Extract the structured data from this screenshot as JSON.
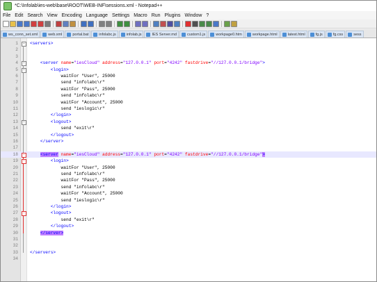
{
  "window": {
    "title": "*C:\\Infolab\\ies-web\\base\\ROOT\\WEB-INF\\sessions.xml - Notepad++"
  },
  "menu": [
    "File",
    "Edit",
    "Search",
    "View",
    "Encoding",
    "Language",
    "Settings",
    "Macro",
    "Run",
    "Plugins",
    "Window",
    "?"
  ],
  "toolbar": {
    "icons": [
      {
        "name": "new-file-icon",
        "color": "#ffffff"
      },
      {
        "name": "open-file-icon",
        "color": "#e8c04a"
      },
      {
        "name": "save-icon",
        "color": "#4a78c8"
      },
      {
        "name": "save-all-icon",
        "color": "#4a78c8"
      },
      {
        "name": "close-icon",
        "color": "#d04040"
      },
      {
        "name": "close-all-icon",
        "color": "#d04040"
      },
      {
        "name": "print-icon",
        "color": "#7a7a7a"
      },
      {
        "name": "sep"
      },
      {
        "name": "cut-icon",
        "color": "#c04040"
      },
      {
        "name": "copy-icon",
        "color": "#6080c0"
      },
      {
        "name": "paste-icon",
        "color": "#c09040"
      },
      {
        "name": "sep"
      },
      {
        "name": "undo-icon",
        "color": "#4070c0"
      },
      {
        "name": "redo-icon",
        "color": "#4070c0"
      },
      {
        "name": "sep"
      },
      {
        "name": "find-icon",
        "color": "#808080"
      },
      {
        "name": "replace-icon",
        "color": "#808080"
      },
      {
        "name": "sep"
      },
      {
        "name": "zoom-in-icon",
        "color": "#3f8f3f"
      },
      {
        "name": "zoom-out-icon",
        "color": "#3f8f3f"
      },
      {
        "name": "sep"
      },
      {
        "name": "sync-v-icon",
        "color": "#6f6fc0"
      },
      {
        "name": "sync-h-icon",
        "color": "#6f6fc0"
      },
      {
        "name": "sep"
      },
      {
        "name": "word-wrap-icon",
        "color": "#5080c0"
      },
      {
        "name": "show-all-chars-icon",
        "color": "#c05050"
      },
      {
        "name": "indent-guide-icon",
        "color": "#5050a0"
      },
      {
        "name": "user-lang-icon",
        "color": "#5080c0"
      },
      {
        "name": "sep"
      },
      {
        "name": "record-macro-icon",
        "color": "#e03030"
      },
      {
        "name": "stop-record-icon",
        "color": "#505050"
      },
      {
        "name": "play-macro-icon",
        "color": "#4a8a4a"
      },
      {
        "name": "run-macro-multiple-icon",
        "color": "#4a8a4a"
      },
      {
        "name": "save-macro-icon",
        "color": "#4a78c8"
      },
      {
        "name": "sep"
      },
      {
        "name": "spell-check-icon",
        "color": "#6aa04a"
      },
      {
        "name": "doc-map-icon",
        "color": "#c0a040"
      }
    ]
  },
  "tabs": [
    {
      "label": "ws_conn_set.xml"
    },
    {
      "label": "web.xml"
    },
    {
      "label": "portal.bat"
    },
    {
      "label": "infolabc.js"
    },
    {
      "label": "infolab.js"
    },
    {
      "label": "IES Server.md"
    },
    {
      "label": "custom1.js"
    },
    {
      "label": "workpage0.htm"
    },
    {
      "label": "workpage.html"
    },
    {
      "label": "latest.html"
    },
    {
      "label": "fg.js"
    },
    {
      "label": "fg.css"
    },
    {
      "label": "sess"
    }
  ],
  "editor": {
    "lines": [
      {
        "n": "1",
        "code": "<servers>"
      },
      {
        "n": "2",
        "code": ""
      },
      {
        "n": "3",
        "code": ""
      },
      {
        "n": "4",
        "code": "    <server name=\"iesCloud\" address=\"127.0.0.1\" port=\"4242\" fastdrive=\"//127.0.0.1/bridge\">"
      },
      {
        "n": "5",
        "code": "        <login>"
      },
      {
        "n": "6",
        "code": "            waitFor \"User\", 25000"
      },
      {
        "n": "7",
        "code": "            send \"infolabc\\r\""
      },
      {
        "n": "8",
        "code": "            waitFor \"Pass\", 25000"
      },
      {
        "n": "9",
        "code": "            send \"infolabc\\r\""
      },
      {
        "n": "10",
        "code": "            waitFor \"Account\", 25000"
      },
      {
        "n": "11",
        "code": "            send \"ieslogic\\r\""
      },
      {
        "n": "12",
        "code": "        </login>"
      },
      {
        "n": "13",
        "code": "        <logout>"
      },
      {
        "n": "14",
        "code": "            send \"exit\\r\""
      },
      {
        "n": "15",
        "code": "        </logout>"
      },
      {
        "n": "16",
        "code": "    </server>"
      },
      {
        "n": "17",
        "code": ""
      },
      {
        "n": "18",
        "code": "    <server name=\"iesCloud\" address=\"127.0.0.1\" port=\"4242\" fastdrive=\"//127.0.0.1/bridge\">"
      },
      {
        "n": "19",
        "code": "        <login>"
      },
      {
        "n": "20",
        "code": "            waitFor \"User\", 25000"
      },
      {
        "n": "21",
        "code": "            send \"infolabc\\r\""
      },
      {
        "n": "22",
        "code": "            waitFor \"Pass\", 25000"
      },
      {
        "n": "23",
        "code": "            send \"infolabc\\r\""
      },
      {
        "n": "24",
        "code": "            waitFor \"Account\", 25000"
      },
      {
        "n": "25",
        "code": "            send \"ieslogic\\r\""
      },
      {
        "n": "26",
        "code": "        </login>"
      },
      {
        "n": "27",
        "code": "        <logout>"
      },
      {
        "n": "28",
        "code": "            send \"exit\\r\""
      },
      {
        "n": "29",
        "code": "        </logout>"
      },
      {
        "n": "30",
        "code": "    </server>"
      },
      {
        "n": "31",
        "code": ""
      },
      {
        "n": "32",
        "code": ""
      },
      {
        "n": "33",
        "code": "</servers>"
      },
      {
        "n": "34",
        "code": ""
      }
    ],
    "current_line": "18",
    "colors": {
      "tag": "#0000ff",
      "attr": "#ff0000",
      "value": "#8000ff",
      "match_bg": "#c080ff",
      "current_line_bg": "#e8e8ff"
    }
  }
}
